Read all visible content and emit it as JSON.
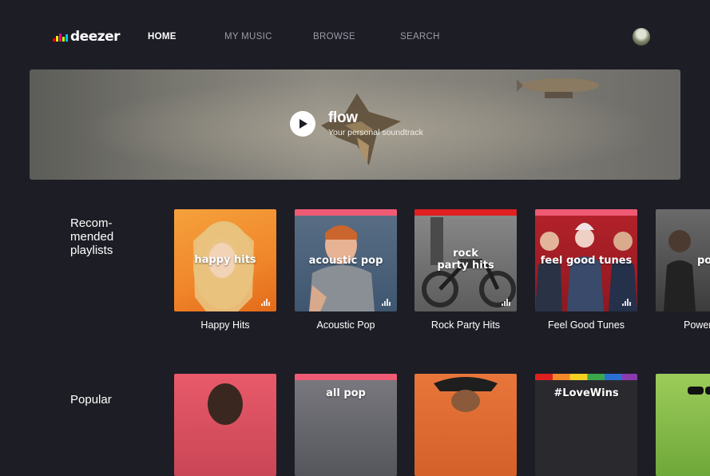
{
  "logo": {
    "text": "deezer",
    "bar_colors": [
      "#ff0000",
      "#ffed00",
      "#ff0092",
      "#c2ff00",
      "#00c7f2",
      "#c1f1fc",
      "#ebffac",
      "#ffa8d4"
    ]
  },
  "nav": [
    {
      "label": "HOME",
      "active": true
    },
    {
      "label": "MY MUSIC",
      "active": false
    },
    {
      "label": "BROWSE",
      "active": false
    },
    {
      "label": "SEARCH",
      "active": false
    }
  ],
  "hero": {
    "title": "flow",
    "subtitle": "Your personal soundtrack"
  },
  "sections": [
    {
      "label": "Recom-\nmended\nplaylists"
    },
    {
      "label": "Popular"
    }
  ],
  "row1": [
    {
      "title": "Happy Hits",
      "cover_text": "happy hits",
      "accent": "#f08a2a"
    },
    {
      "title": "Acoustic Pop",
      "cover_text": "acoustic pop",
      "accent": "#ef5a74"
    },
    {
      "title": "Rock Party Hits",
      "cover_text": "rock\nparty hits",
      "accent": "#e02020"
    },
    {
      "title": "Feel Good Tunes",
      "cover_text": "feel good tunes",
      "accent": "#ef5a74"
    },
    {
      "title": "Power",
      "cover_text": "po",
      "accent": "#555555"
    }
  ],
  "row2": [
    {
      "cover_text": "",
      "accent": "#ef5a74"
    },
    {
      "cover_text": "all pop",
      "accent": "#ef5a74"
    },
    {
      "cover_text": "",
      "accent": "#e05a1f"
    },
    {
      "cover_text": "#LoveWins",
      "accent": "#e02020"
    },
    {
      "cover_text": "",
      "accent": "#8bc34a"
    }
  ]
}
